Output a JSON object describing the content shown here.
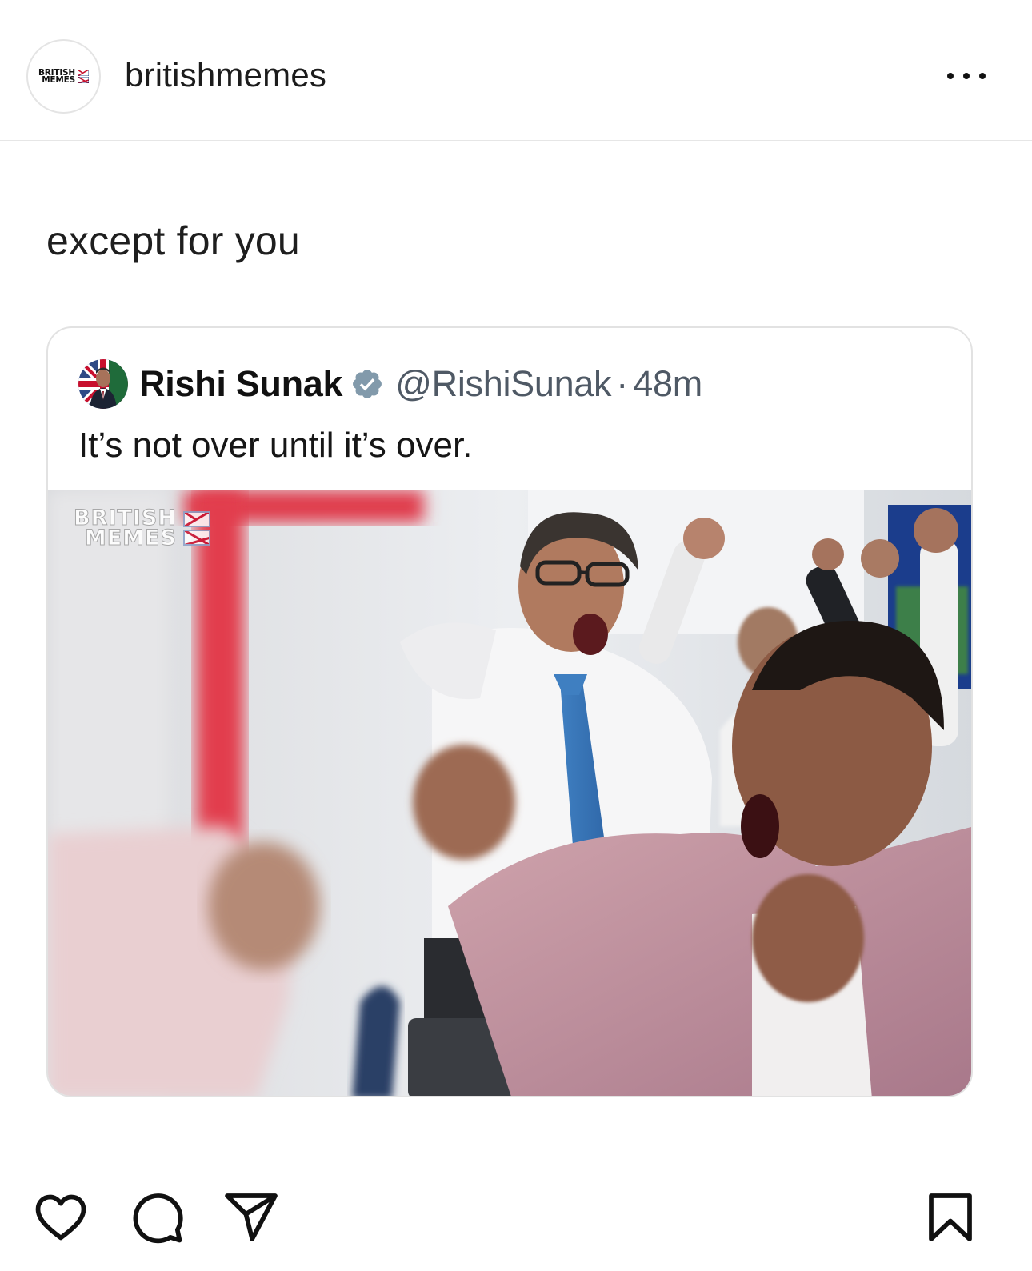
{
  "header": {
    "username": "britishmemes",
    "avatar_logo_line1": "BRITISH",
    "avatar_logo_line2": "MEMES",
    "more_icon": "more-horizontal-icon"
  },
  "post": {
    "caption": "except for you"
  },
  "embedded_tweet": {
    "author_name": "Rishi Sunak",
    "verified_icon": "verified-badge-icon",
    "handle": "@RishiSunak",
    "separator": "·",
    "time": "48m",
    "text": "It’s not over until it’s over.",
    "photo": {
      "description_icon": "celebration-photo",
      "watermark_line1": "BRITISH",
      "watermark_line2": "MEMES"
    }
  },
  "actions": {
    "like_icon": "heart-icon",
    "comment_icon": "comment-icon",
    "share_icon": "send-icon",
    "save_icon": "bookmark-icon"
  },
  "colors": {
    "text": "#111111",
    "muted": "#4f5965",
    "verified": "#829aab",
    "border": "#e2e2e2",
    "flag_red": "#c8102e",
    "flag_blue": "#012169"
  }
}
